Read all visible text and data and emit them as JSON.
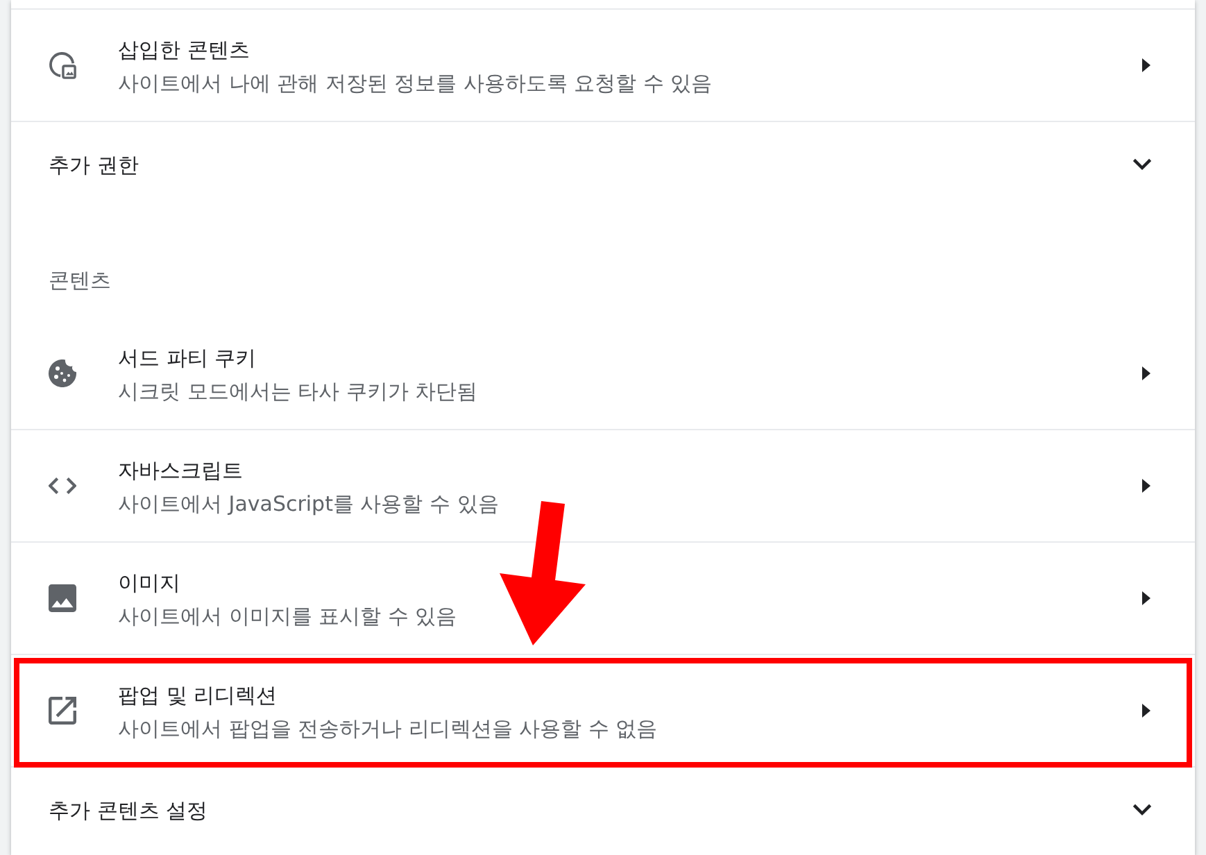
{
  "items": [
    {
      "kind": "link",
      "title": "삽입한 콘텐츠",
      "description": "사이트에서 나에 관해 저장된 정보를 사용하도록 요청할 수 있음",
      "highlighted": false
    },
    {
      "kind": "expander",
      "label": "추가 권한",
      "expanded": false
    },
    {
      "kind": "heading",
      "label": "콘텐츠"
    },
    {
      "kind": "link",
      "title": "서드 파티 쿠키",
      "description": "시크릿 모드에서는 타사 쿠키가 차단됨",
      "highlighted": false
    },
    {
      "kind": "link",
      "title": "자바스크립트",
      "description": "사이트에서 JavaScript를 사용할 수 있음",
      "highlighted": false
    },
    {
      "kind": "link",
      "title": "이미지",
      "description": "사이트에서 이미지를 표시할 수 있음",
      "highlighted": false
    },
    {
      "kind": "link",
      "title": "팝업 및 리디렉션",
      "description": "사이트에서 팝업을 전송하거나 리디렉션을 사용할 수 없음",
      "highlighted": true
    },
    {
      "kind": "expander",
      "label": "추가 콘텐츠 설정",
      "expanded": false
    }
  ]
}
